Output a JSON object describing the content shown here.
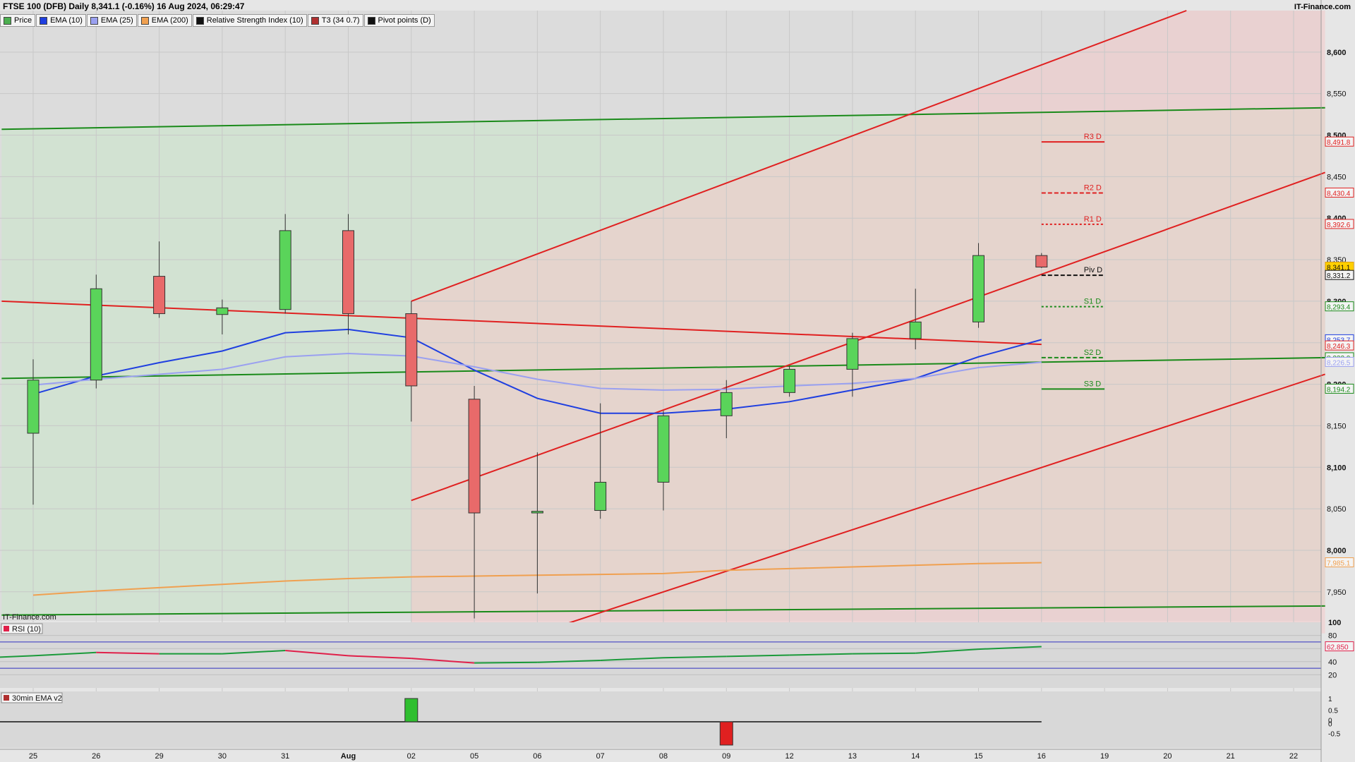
{
  "header": {
    "title": "FTSE 100 (DFB) Daily 8,341.1 (-0.16%) 16 Aug 2024, 06:29:47",
    "brand": "IT-Finance.com",
    "watermark": "IT-Finance.com"
  },
  "legend": [
    {
      "label": "Price",
      "color": "#4caf50"
    },
    {
      "label": "EMA (10)",
      "color": "#1f3fe0"
    },
    {
      "label": "EMA (25)",
      "color": "#9aa0f0"
    },
    {
      "label": "EMA (200)",
      "color": "#f0a050"
    },
    {
      "label": "Relative Strength Index (10)",
      "color": "#111111"
    },
    {
      "label": "T3 (34 0.7)",
      "color": "#b03030"
    },
    {
      "label": "Pivot points (D)",
      "color": "#111111"
    }
  ],
  "rsi_panel": {
    "label": "RSI (10)",
    "ticks": [
      "100",
      "80",
      "60",
      "40",
      "20"
    ],
    "last_value": "62.850"
  },
  "ema_panel": {
    "label": "30min EMA v2",
    "ticks": [
      "1",
      "0.5",
      "0",
      "0",
      "-0.5"
    ]
  },
  "chart_data": {
    "type": "candlestick",
    "title": "FTSE 100 (DFB) Daily 8,341.1 (-0.16%) 16 Aug 2024, 06:29:47",
    "ylim": [
      7915,
      8650
    ],
    "y_ticks": [
      "7,950",
      "8,000",
      "8,050",
      "8,100",
      "8,150",
      "8,200",
      "8,250",
      "8,300",
      "8,350",
      "8,400",
      "8,450",
      "8,500",
      "8,550",
      "8,600"
    ],
    "x_labels": [
      "25",
      "26",
      "29",
      "30",
      "31",
      "Aug",
      "02",
      "05",
      "06",
      "07",
      "08",
      "09",
      "12",
      "13",
      "14",
      "15",
      "16",
      "19",
      "20",
      "21",
      "22"
    ],
    "candles": [
      {
        "date": "25",
        "open": 8141,
        "high": 8230,
        "low": 8055,
        "close": 8205
      },
      {
        "date": "26",
        "open": 8205,
        "high": 8332,
        "low": 8195,
        "close": 8315
      },
      {
        "date": "29",
        "open": 8330,
        "high": 8372,
        "low": 8280,
        "close": 8285
      },
      {
        "date": "30",
        "open": 8284,
        "high": 8302,
        "low": 8260,
        "close": 8292
      },
      {
        "date": "31",
        "open": 8290,
        "high": 8405,
        "low": 8285,
        "close": 8385
      },
      {
        "date": "Aug",
        "open": 8385,
        "high": 8405,
        "low": 8260,
        "close": 8285
      },
      {
        "date": "02",
        "open": 8285,
        "high": 8300,
        "low": 8155,
        "close": 8198
      },
      {
        "date": "05",
        "open": 8182,
        "high": 8198,
        "low": 7918,
        "close": 8045
      },
      {
        "date": "06",
        "open": 8045,
        "high": 8118,
        "low": 7948,
        "close": 8047
      },
      {
        "date": "07",
        "open": 8048,
        "high": 8177,
        "low": 8038,
        "close": 8082
      },
      {
        "date": "08",
        "open": 8082,
        "high": 8168,
        "low": 8048,
        "close": 8162
      },
      {
        "date": "09",
        "open": 8162,
        "high": 8205,
        "low": 8135,
        "close": 8190
      },
      {
        "date": "12",
        "open": 8190,
        "high": 8222,
        "low": 8185,
        "close": 8218
      },
      {
        "date": "13",
        "open": 8218,
        "high": 8262,
        "low": 8185,
        "close": 8255
      },
      {
        "date": "14",
        "open": 8255,
        "high": 8315,
        "low": 8242,
        "close": 8275
      },
      {
        "date": "15",
        "open": 8275,
        "high": 8370,
        "low": 8268,
        "close": 8355
      },
      {
        "date": "16",
        "open": 8355,
        "high": 8358,
        "low": 8340,
        "close": 8341.1
      }
    ],
    "series": [
      {
        "name": "EMA (10)",
        "color": "#1f3fe0",
        "values": [
          8185,
          8188,
          8210,
          8226,
          8240,
          8262,
          8266,
          8256,
          8217,
          8183,
          8165,
          8165,
          8170,
          8179,
          8193,
          8207,
          8233,
          8253.7
        ]
      },
      {
        "name": "EMA (25)",
        "color": "#9aa0f0",
        "values": [
          8198,
          8199,
          8206,
          8212,
          8218,
          8233,
          8237,
          8234,
          8221,
          8206,
          8195,
          8193,
          8194,
          8198,
          8201,
          8207,
          8220,
          8226.5
        ]
      },
      {
        "name": "EMA (200)",
        "color": "#f0a050",
        "values": [
          7941,
          7946,
          7951,
          7955,
          7959,
          7963,
          7966,
          7968,
          7969,
          7970,
          7971,
          7972,
          7976,
          7978,
          7980,
          7982,
          7984,
          7985.1
        ]
      }
    ],
    "pivots": [
      {
        "label": "R3 D",
        "value": 8491.8,
        "color": "#e02020",
        "style": "solid"
      },
      {
        "label": "R2 D",
        "value": 8430.4,
        "color": "#e02020",
        "style": "dashed"
      },
      {
        "label": "R1 D",
        "value": 8392.6,
        "color": "#e02020",
        "style": "dotted"
      },
      {
        "label": "Piv D",
        "value": 8331.2,
        "color": "#111111",
        "style": "dashed"
      },
      {
        "label": "S1 D",
        "value": 8293.4,
        "color": "#1a8a1a",
        "style": "dotted"
      },
      {
        "label": "S2 D",
        "value": 8232.0,
        "color": "#1a8a1a",
        "style": "dashed"
      },
      {
        "label": "S3 D",
        "value": 8194.2,
        "color": "#1a8a1a",
        "style": "solid"
      }
    ],
    "price_labels": [
      {
        "text": "8,491.8",
        "value": 8491.8,
        "color": "#e02020"
      },
      {
        "text": "8,430.4",
        "value": 8430.4,
        "color": "#e02020"
      },
      {
        "text": "8,392.6",
        "value": 8392.6,
        "color": "#e02020"
      },
      {
        "text": "8,341.1",
        "value": 8341.1,
        "color": "#e0a000",
        "fill": "#ffd000"
      },
      {
        "text": "8,331.2",
        "value": 8331.2,
        "color": "#111111"
      },
      {
        "text": "8,293.4",
        "value": 8293.4,
        "color": "#1a8a1a"
      },
      {
        "text": "8,253.7",
        "value": 8253.7,
        "color": "#1f3fe0"
      },
      {
        "text": "8,246.3",
        "value": 8246.3,
        "color": "#e02020"
      },
      {
        "text": "8,232.0",
        "value": 8232.0,
        "color": "#1a8a1a"
      },
      {
        "text": "8,226.5",
        "value": 8226.5,
        "color": "#9aa0f0"
      },
      {
        "text": "8,194.2",
        "value": 8194.2,
        "color": "#1a8a1a"
      },
      {
        "text": "7,985.1",
        "value": 7985.1,
        "color": "#f0a050"
      }
    ],
    "trendlines": [
      {
        "color": "#1a8a1a",
        "from": [
          -0.5,
          8507
        ],
        "to": [
          20.5,
          8533
        ]
      },
      {
        "color": "#1a8a1a",
        "from": [
          -0.5,
          8207
        ],
        "to": [
          20.5,
          8232
        ]
      },
      {
        "color": "#1a8a1a",
        "from": [
          -0.5,
          7922
        ],
        "to": [
          20.5,
          7933
        ]
      },
      {
        "color": "#e02020",
        "from": [
          -0.5,
          8300
        ],
        "to": [
          16,
          8248
        ]
      },
      {
        "color": "#e02020",
        "from": [
          6,
          8300
        ],
        "to": [
          18.3,
          8650
        ]
      },
      {
        "color": "#e02020",
        "from": [
          6,
          8060
        ],
        "to": [
          20.5,
          8455
        ]
      },
      {
        "color": "#e02020",
        "from": [
          8,
          7900
        ],
        "to": [
          20.5,
          8212
        ]
      }
    ],
    "rsi": {
      "ylim": [
        0,
        100
      ],
      "values": [
        45,
        49,
        54,
        52,
        52,
        57,
        49,
        45,
        38,
        39,
        42,
        46,
        48,
        50,
        52,
        53,
        59,
        62.85
      ],
      "overbought": 70,
      "oversold": 30
    },
    "ema30_bars": [
      {
        "index": 6,
        "value": 1
      },
      {
        "index": 11,
        "value": -1
      }
    ]
  }
}
